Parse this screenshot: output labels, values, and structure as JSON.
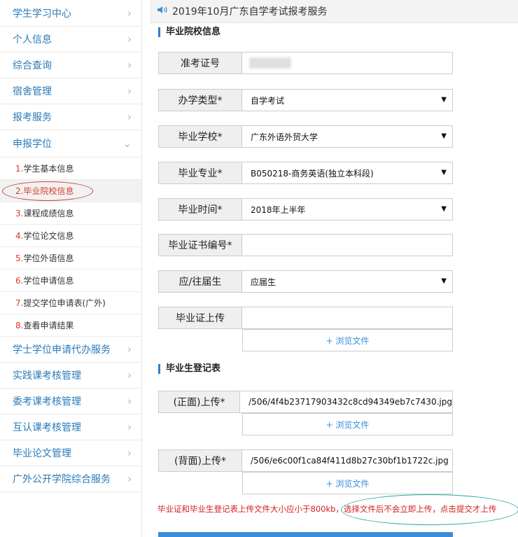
{
  "sidebar": {
    "top_items": [
      {
        "label": "学生学习中心"
      },
      {
        "label": "个人信息"
      },
      {
        "label": "综合查询"
      },
      {
        "label": "宿舍管理"
      },
      {
        "label": "报考服务"
      },
      {
        "label": "申报学位"
      }
    ],
    "sub_items": [
      {
        "num": "1.",
        "label": "学生基本信息"
      },
      {
        "num": "2.",
        "label": "毕业院校信息"
      },
      {
        "num": "3.",
        "label": "课程成绩信息"
      },
      {
        "num": "4.",
        "label": "学位论文信息"
      },
      {
        "num": "5.",
        "label": "学位外语信息"
      },
      {
        "num": "6.",
        "label": "学位申请信息"
      },
      {
        "num": "7.",
        "label": "提交学位申请表(广外)"
      },
      {
        "num": "8.",
        "label": "查看申请结果"
      }
    ],
    "bottom_items": [
      {
        "label": "学士学位申请代办服务"
      },
      {
        "label": "实践课考核管理"
      },
      {
        "label": "委考课考核管理"
      },
      {
        "label": "互认课考核管理"
      },
      {
        "label": "毕业论文管理"
      },
      {
        "label": "广外公开学院综合服务"
      }
    ],
    "chevron_right": "›",
    "chevron_down": "⌄"
  },
  "header": {
    "notice": "2019年10月广东自学考试报考服务",
    "icon": "speaker-icon"
  },
  "section1": {
    "title": "毕业院校信息"
  },
  "form1": {
    "exam_id": {
      "label": "准考证号",
      "value": ""
    },
    "school_type": {
      "label": "办学类型*",
      "value": "自学考试"
    },
    "school": {
      "label": "毕业学校*",
      "value": "广东外语外贸大学"
    },
    "major": {
      "label": "毕业专业*",
      "value": "B050218-商务英语(独立本科段)"
    },
    "grad_time": {
      "label": "毕业时间*",
      "value": "2018年上半年"
    },
    "cert_no": {
      "label": "毕业证书编号*",
      "value": ""
    },
    "grad_status": {
      "label": "应/往届生",
      "value": "应届生"
    },
    "cert_upload": {
      "label": "毕业证上传",
      "value": ""
    },
    "browse_label": "+ 浏览文件"
  },
  "section2": {
    "title": "毕业生登记表"
  },
  "form2": {
    "front": {
      "label": "(正面)上传*",
      "value": "/506/4f4b23717903432c8cd94349eb7c7430.jpg"
    },
    "back": {
      "label": "(背面)上传*",
      "value": "/506/e6c00f1ca84f411d8b27c30bf1b1722c.jpg"
    },
    "browse_label": "+ 浏览文件"
  },
  "notice_text": "毕业证和毕业生登记表上传文件大小应小于800kb，选择文件后不会立即上传，点击提交才上传",
  "colors": {
    "accent": "#3a8fd9",
    "sidebar_link": "#2a7ab8",
    "warning": "#d41f1f"
  }
}
